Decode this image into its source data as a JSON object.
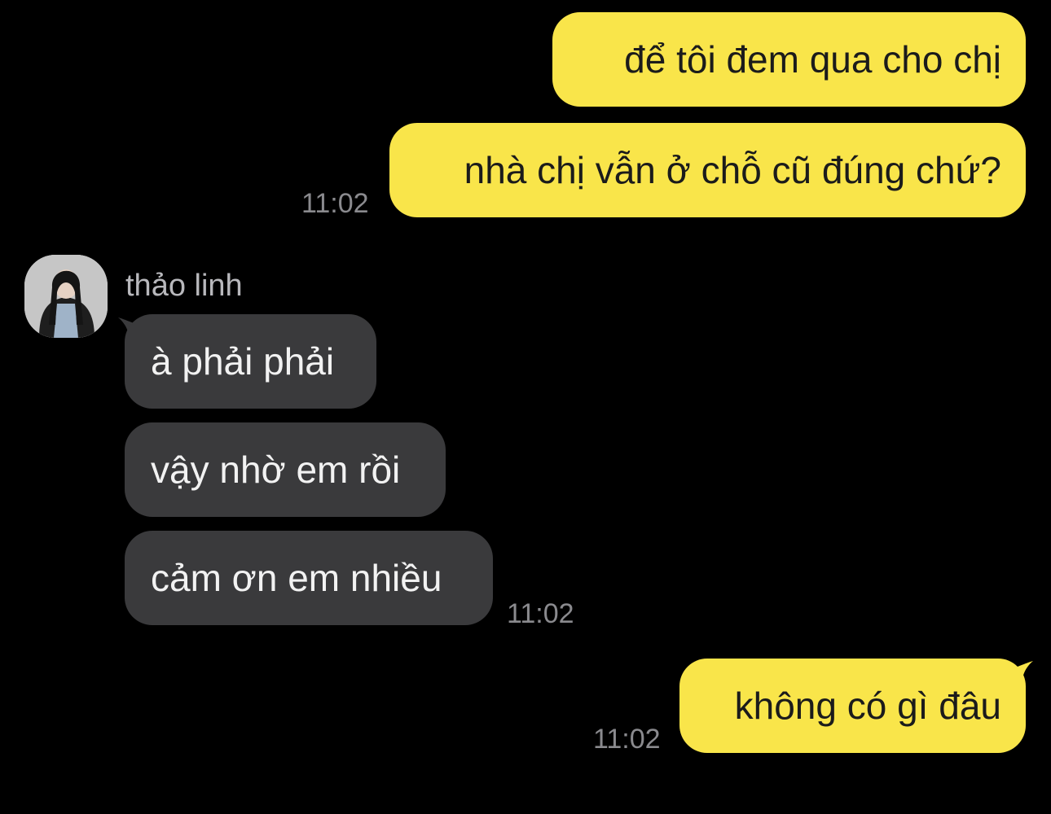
{
  "colors": {
    "background": "#000000",
    "my_bubble": "#f9e54a",
    "their_bubble": "#3a3a3c",
    "timestamp": "#8a8a8e"
  },
  "conversation": {
    "contact": {
      "name": "thảo linh",
      "avatar_icon": "profile-photo-icon"
    },
    "messages": [
      {
        "from": "me",
        "text": "để tôi đem qua cho chị"
      },
      {
        "from": "me",
        "text": "nhà chị vẫn ở chỗ cũ đúng chứ?",
        "time": "11:02"
      },
      {
        "from": "contact",
        "text": "à phải phải"
      },
      {
        "from": "contact",
        "text": "vậy nhờ em rồi"
      },
      {
        "from": "contact",
        "text": "cảm ơn em nhiều",
        "time": "11:02"
      },
      {
        "from": "me",
        "text": "không có gì đâu",
        "time": "11:02"
      }
    ]
  }
}
